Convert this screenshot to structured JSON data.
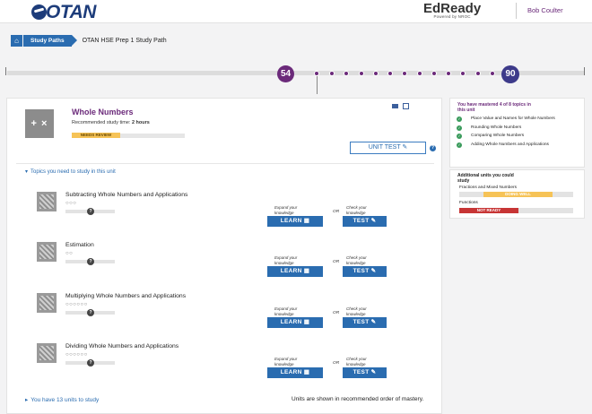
{
  "header": {
    "logo": "OTAN",
    "brand_name": "EdReady",
    "brand_sub": "Powered by NROC",
    "user_name": "Bob Coulter"
  },
  "breadcrumb": {
    "section": "Study Paths",
    "current": "OTAN HSE Prep 1 Study Path"
  },
  "progress": {
    "start_score": "54",
    "target_score": "90"
  },
  "unit": {
    "title": "Whole Numbers",
    "study_time_label": "Recommended study time:",
    "study_time_value": "2 hours",
    "status_label": "NEEDS REVIEW",
    "unit_test_label": "UNIT TEST",
    "topics_header": "Topics you need to study in this unit",
    "topics": [
      {
        "name": "Subtracting Whole Numbers and Applications",
        "circles": "○○○"
      },
      {
        "name": "Estimation",
        "circles": "○○"
      },
      {
        "name": "Multiplying Whole Numbers and Applications",
        "circles": "○○○○○○"
      },
      {
        "name": "Dividing Whole Numbers and Applications",
        "circles": "○○○○○○"
      }
    ],
    "expand_label": "Expand your knowledge",
    "check_label": "Check your knowledge",
    "or_label": "OR",
    "learn_label": "LEARN",
    "test_label": "TEST",
    "units_to_study": "You have 13 units to study",
    "order_note": "Units are shown in recommended order of mastery."
  },
  "mastery": {
    "header": "You have mastered 4 of 8 topics in this unit",
    "topics": [
      "Place Value and Names for Whole Numbers",
      "Rounding Whole Numbers",
      "Comparing Whole Numbers",
      "Adding Whole Numbers and Applications"
    ]
  },
  "additional": {
    "header": "Additional units you could study",
    "items": [
      {
        "name": "Fractions and Mixed Numbers",
        "status": "DOING WELL"
      },
      {
        "name": "Functions",
        "status": "NOT READY"
      }
    ]
  },
  "colors": {
    "accent": "#6b2a7a",
    "primary": "#2a6cb0",
    "needs_review": "#f6c357",
    "not_ready": "#c73535",
    "mastered": "#3a9b5c"
  }
}
